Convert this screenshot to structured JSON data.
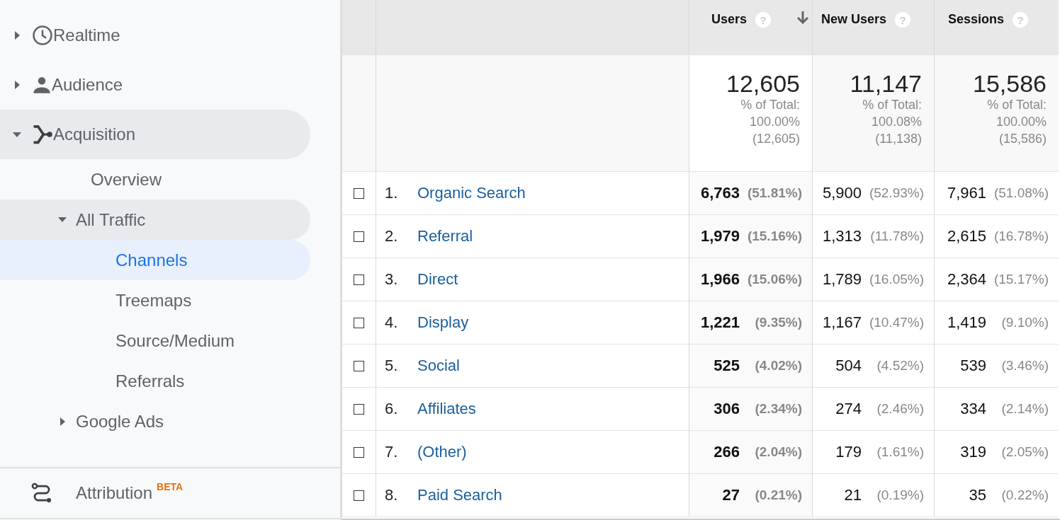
{
  "sidebar": {
    "items": [
      {
        "label": "Realtime",
        "expanded": false,
        "selected": false
      },
      {
        "label": "Audience",
        "expanded": false,
        "selected": false
      },
      {
        "label": "Acquisition",
        "expanded": true,
        "selected": false,
        "children": [
          {
            "label": "Overview",
            "selected": false
          },
          {
            "label": "All Traffic",
            "expanded": true,
            "selected": false,
            "children": [
              {
                "label": "Channels",
                "selected": true
              },
              {
                "label": "Treemaps",
                "selected": false
              },
              {
                "label": "Source/Medium",
                "selected": false
              },
              {
                "label": "Referrals",
                "selected": false
              }
            ]
          },
          {
            "label": "Google Ads",
            "expanded": false,
            "selected": false
          }
        ]
      }
    ],
    "footer": {
      "label": "Attribution",
      "badge": "BETA"
    }
  },
  "table": {
    "columns": [
      {
        "label": "Users",
        "hint": "?",
        "sorted": true
      },
      {
        "label": "New Users",
        "hint": "?",
        "sorted": false
      },
      {
        "label": "Sessions",
        "hint": "?",
        "sorted": false
      }
    ],
    "totals": [
      {
        "value": "12,605",
        "label": "% of Total:",
        "percent": "100.00%",
        "total": "(12,605)"
      },
      {
        "value": "11,147",
        "label": "% of Total:",
        "percent": "100.08%",
        "total": "(11,138)"
      },
      {
        "value": "15,586",
        "label": "% of Total:",
        "percent": "100.00%",
        "total": "(15,586)"
      }
    ],
    "rows": [
      {
        "index": "1.",
        "name": "Organic Search",
        "checked": false,
        "cells": [
          {
            "value": "6,763",
            "percent": "(51.81%)"
          },
          {
            "value": "5,900",
            "percent": "(52.93%)"
          },
          {
            "value": "7,961",
            "percent": "(51.08%)"
          }
        ]
      },
      {
        "index": "2.",
        "name": "Referral",
        "checked": false,
        "cells": [
          {
            "value": "1,979",
            "percent": "(15.16%)"
          },
          {
            "value": "1,313",
            "percent": "(11.78%)"
          },
          {
            "value": "2,615",
            "percent": "(16.78%)"
          }
        ]
      },
      {
        "index": "3.",
        "name": "Direct",
        "checked": false,
        "cells": [
          {
            "value": "1,966",
            "percent": "(15.06%)"
          },
          {
            "value": "1,789",
            "percent": "(16.05%)"
          },
          {
            "value": "2,364",
            "percent": "(15.17%)"
          }
        ]
      },
      {
        "index": "4.",
        "name": "Display",
        "checked": false,
        "cells": [
          {
            "value": "1,221",
            "percent": "(9.35%)"
          },
          {
            "value": "1,167",
            "percent": "(10.47%)"
          },
          {
            "value": "1,419",
            "percent": "(9.10%)"
          }
        ]
      },
      {
        "index": "5.",
        "name": "Social",
        "checked": false,
        "cells": [
          {
            "value": "525",
            "percent": "(4.02%)"
          },
          {
            "value": "504",
            "percent": "(4.52%)"
          },
          {
            "value": "539",
            "percent": "(3.46%)"
          }
        ]
      },
      {
        "index": "6.",
        "name": "Affiliates",
        "checked": false,
        "cells": [
          {
            "value": "306",
            "percent": "(2.34%)"
          },
          {
            "value": "274",
            "percent": "(2.46%)"
          },
          {
            "value": "334",
            "percent": "(2.14%)"
          }
        ]
      },
      {
        "index": "7.",
        "name": "(Other)",
        "checked": false,
        "cells": [
          {
            "value": "266",
            "percent": "(2.04%)"
          },
          {
            "value": "179",
            "percent": "(1.61%)"
          },
          {
            "value": "319",
            "percent": "(2.05%)"
          }
        ]
      },
      {
        "index": "8.",
        "name": "Paid Search",
        "checked": false,
        "cells": [
          {
            "value": "27",
            "percent": "(0.21%)"
          },
          {
            "value": "21",
            "percent": "(0.19%)"
          },
          {
            "value": "35",
            "percent": "(0.22%)"
          }
        ]
      }
    ]
  }
}
